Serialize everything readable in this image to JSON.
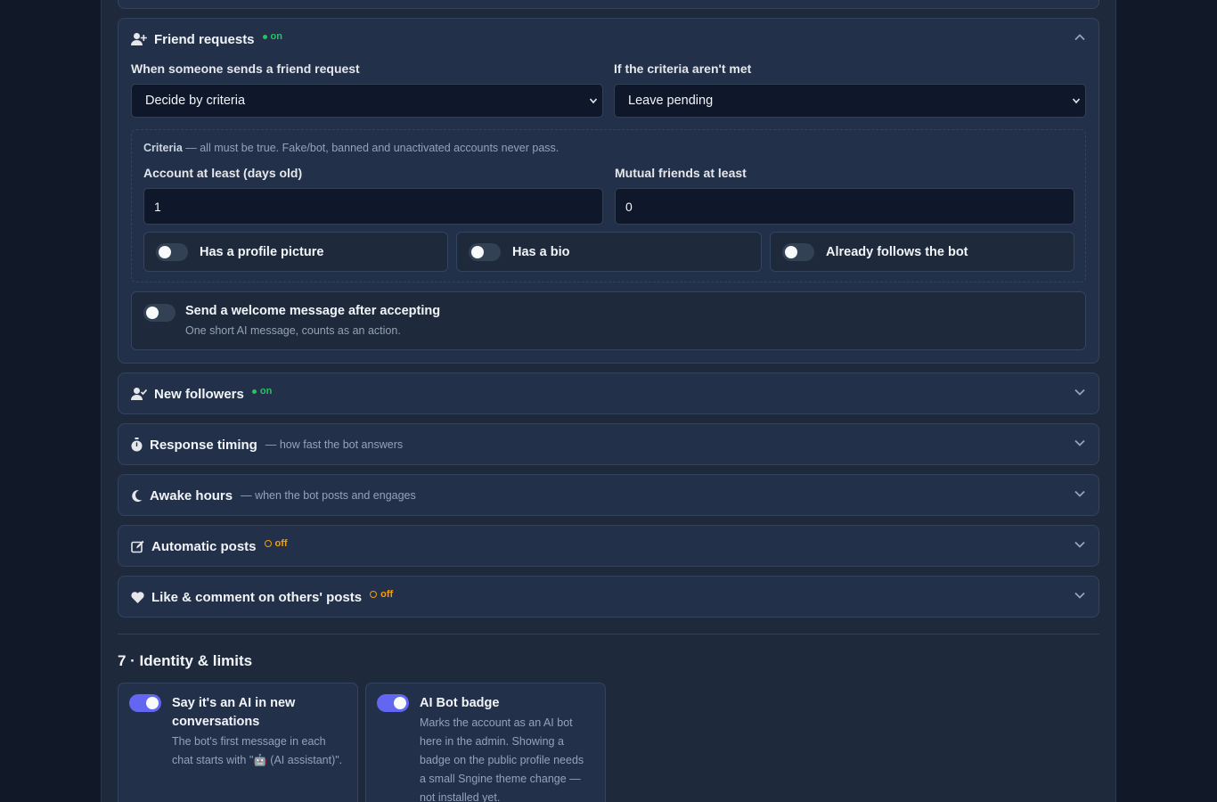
{
  "friend_requests": {
    "title": "Friend requests",
    "status": "on",
    "when_label": "When someone sends a friend request",
    "when_value": "Decide by criteria",
    "else_label": "If the criteria aren't met",
    "else_value": "Leave pending",
    "criteria_note_bold": "Criteria",
    "criteria_note_rest": " — all must be true. Fake/bot, banned and unactivated accounts never pass.",
    "age_label": "Account at least (days old)",
    "age_value": "1",
    "mutual_label": "Mutual friends at least",
    "mutual_value": "0",
    "toggles": [
      {
        "label": "Has a profile picture",
        "on": false
      },
      {
        "label": "Has a bio",
        "on": false
      },
      {
        "label": "Already follows the bot",
        "on": false
      }
    ],
    "welcome_title": "Send a welcome message after accepting",
    "welcome_sub": "One short AI message, counts as an action."
  },
  "sections": [
    {
      "title": "New followers",
      "status": "on",
      "icon": "user-check-icon"
    },
    {
      "title": "Response timing",
      "sub": "— how fast the bot answers",
      "icon": "stopwatch-icon"
    },
    {
      "title": "Awake hours",
      "sub": "— when the bot posts and engages",
      "icon": "moon-icon"
    },
    {
      "title": "Automatic posts",
      "status": "off",
      "icon": "edit-icon"
    },
    {
      "title": "Like & comment on others' posts",
      "status": "off",
      "icon": "heart-icon"
    }
  ],
  "identity": {
    "title": "7 · Identity & limits",
    "cards": [
      {
        "title": "Say it's an AI in new conversations",
        "desc": "The bot's first message in each chat starts with \"🤖 (AI assistant)\".",
        "on": true
      },
      {
        "title": "AI Bot badge",
        "desc": "Marks the account as an AI bot here in the admin. Showing a badge on the public profile needs a small Sngine theme change — not installed yet.",
        "on": true
      }
    ]
  },
  "colors": {
    "accent": "#6366f1",
    "on": "#22c55e",
    "off": "#f59e0b"
  }
}
